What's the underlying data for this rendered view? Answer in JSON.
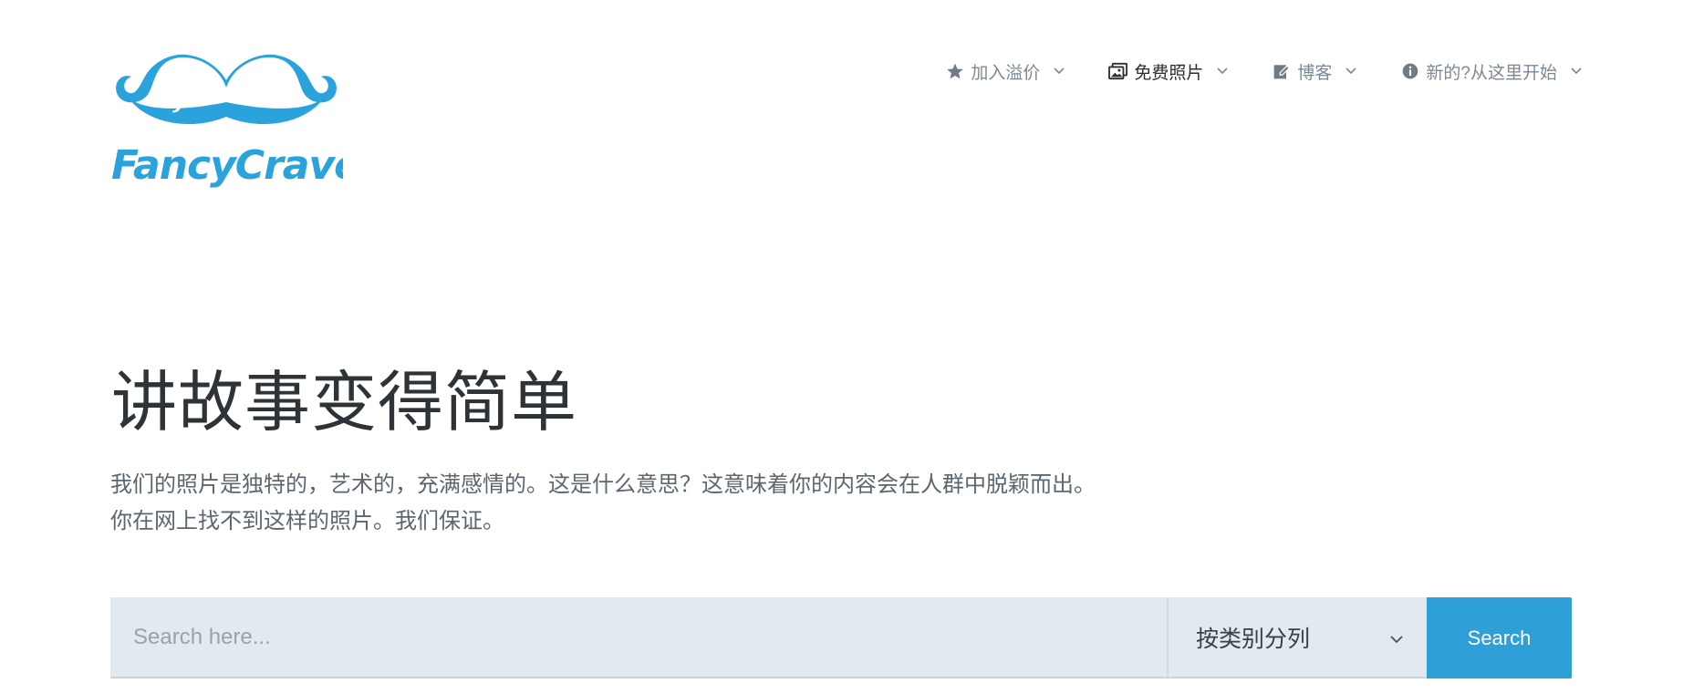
{
  "brand": {
    "logo_name": "FancyCrave",
    "logo_color": "#2aa2dc"
  },
  "nav": {
    "items": [
      {
        "label": "加入溢价",
        "icon": "star-icon",
        "active": false
      },
      {
        "label": "免费照片",
        "icon": "photos-icon",
        "active": true
      },
      {
        "label": "博客",
        "icon": "edit-icon",
        "active": false
      },
      {
        "label": "新的?从这里开始",
        "icon": "info-icon",
        "active": false
      }
    ]
  },
  "hero": {
    "title": "讲故事变得简单",
    "description_line1": "我们的照片是独特的，艺术的，充满感情的。这是什么意思？这意味着你的内容会在人群中脱颖而出。",
    "description_line2": "你在网上找不到这样的照片。我们保证。"
  },
  "search": {
    "placeholder": "Search here...",
    "value": "",
    "category_selected": "按类别分列",
    "button_label": "Search"
  },
  "colors": {
    "accent": "#2f9fd8",
    "input_bg": "#e2e9ef",
    "text_dark": "#2e3338",
    "text_muted": "#7d8893"
  }
}
